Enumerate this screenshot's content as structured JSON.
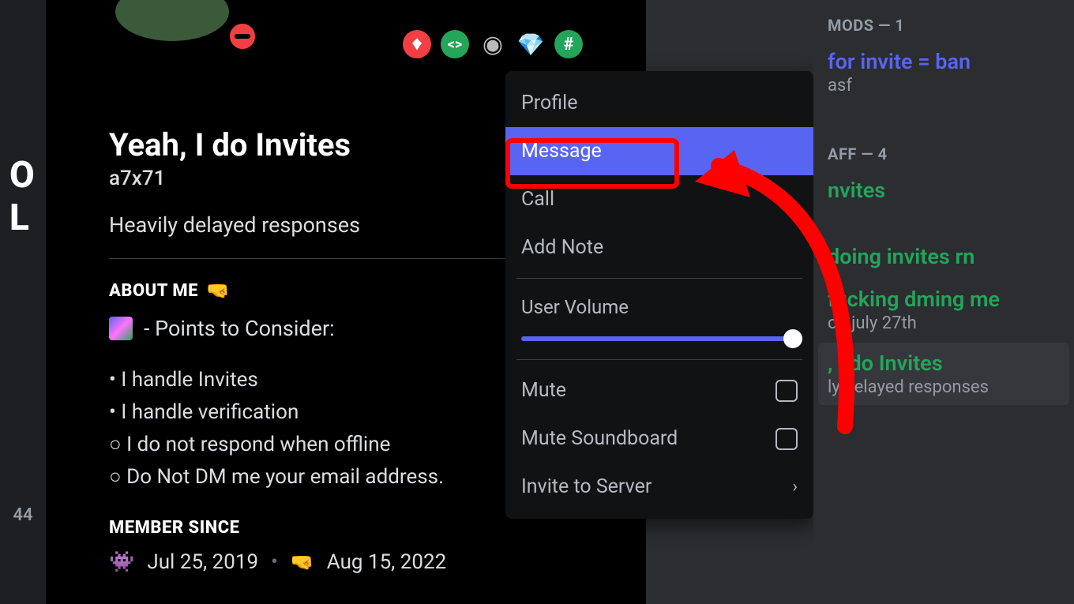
{
  "profile": {
    "display_name": "Yeah, I do Invites",
    "username": "a7x71",
    "status_text": "Heavily delayed responses",
    "about_title": "ABOUT ME",
    "about_heading": "- Points to Consider:",
    "about_lines": [
      "• I handle Invites",
      "• I handle verification",
      "○ I do not respond when offline",
      "○ Do Not DM me your email address."
    ],
    "member_since_title": "MEMBER SINCE",
    "discord_date": "Jul 25, 2019",
    "server_date": "Aug 15, 2022"
  },
  "context_menu": {
    "profile": "Profile",
    "message": "Message",
    "call": "Call",
    "add_note": "Add Note",
    "user_volume": "User Volume",
    "mute": "Mute",
    "mute_soundboard": "Mute Soundboard",
    "invite_to_server": "Invite to Server"
  },
  "sidebar": {
    "mods_header": "MODS — 1",
    "staff_header": "AFF — 4",
    "members": [
      {
        "name": "for invite = ban",
        "sub": "asf",
        "color": "c-blue"
      },
      {
        "name": "nvites",
        "sub": "",
        "color": "c-green"
      },
      {
        "name": "doing invites rn",
        "sub": "",
        "color": "c-green"
      },
      {
        "name": "fucking dming me",
        "sub": "on july 27th",
        "color": "c-green"
      },
      {
        "name": ", I do Invites",
        "sub": "ly delayed responses",
        "color": "c-green"
      }
    ]
  },
  "left": {
    "num": "44",
    "letter": "O L"
  }
}
